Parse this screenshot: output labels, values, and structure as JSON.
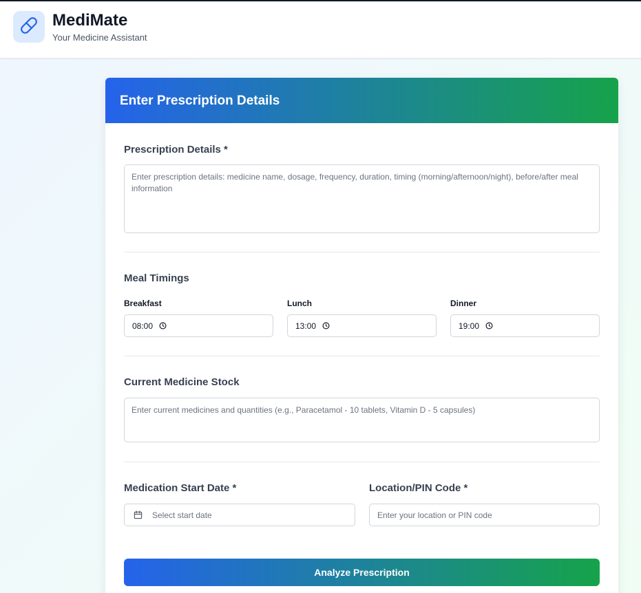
{
  "app": {
    "title": "MediMate",
    "subtitle": "Your Medicine Assistant",
    "logo_icon": "pill-icon"
  },
  "form": {
    "title": "Enter Prescription Details",
    "prescription": {
      "label": "Prescription Details *",
      "placeholder": "Enter prescription details: medicine name, dosage, frequency, duration, timing (morning/afternoon/night), before/after meal information"
    },
    "meal_timings": {
      "label": "Meal Timings",
      "breakfast": {
        "label": "Breakfast",
        "value": "08:00"
      },
      "lunch": {
        "label": "Lunch",
        "value": "13:00"
      },
      "dinner": {
        "label": "Dinner",
        "value": "19:00"
      }
    },
    "stock": {
      "label": "Current Medicine Stock",
      "placeholder": "Enter current medicines and quantities (e.g., Paracetamol - 10 tablets, Vitamin D - 5 capsules)"
    },
    "start_date": {
      "label": "Medication Start Date *",
      "placeholder": "Select start date"
    },
    "location": {
      "label": "Location/PIN Code *",
      "placeholder": "Enter your location or PIN code"
    },
    "submit_label": "Analyze Prescription"
  },
  "colors": {
    "gradient_start": "#2563eb",
    "gradient_end": "#16a34a",
    "logo_bg": "#dbeafe"
  }
}
